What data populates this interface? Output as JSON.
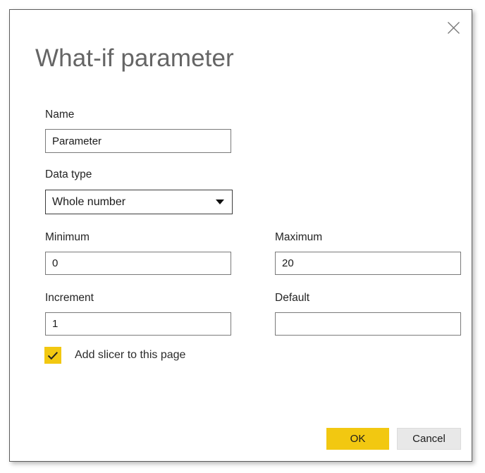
{
  "dialog": {
    "title": "What-if parameter",
    "close_icon": "close-icon"
  },
  "fields": {
    "name": {
      "label": "Name",
      "value": "Parameter",
      "placeholder": ""
    },
    "data_type": {
      "label": "Data type",
      "value": "Whole number",
      "arrow_icon": "chevron-down-icon"
    },
    "minimum": {
      "label": "Minimum",
      "value": "0",
      "placeholder": ""
    },
    "maximum": {
      "label": "Maximum",
      "value": "20",
      "placeholder": ""
    },
    "increment": {
      "label": "Increment",
      "value": "1",
      "placeholder": ""
    },
    "default": {
      "label": "Default",
      "value": "",
      "placeholder": ""
    }
  },
  "checkbox": {
    "label": "Add slicer to this page",
    "checked": true,
    "check_icon": "checkmark-icon"
  },
  "buttons": {
    "ok": "OK",
    "cancel": "Cancel"
  },
  "colors": {
    "accent": "#F2C811",
    "title_text": "#656565",
    "body_text": "#242424",
    "dialog_border": "#5C5C5C",
    "input_border": "#7A7A7A",
    "cancel_bg": "#E8E8E8"
  }
}
